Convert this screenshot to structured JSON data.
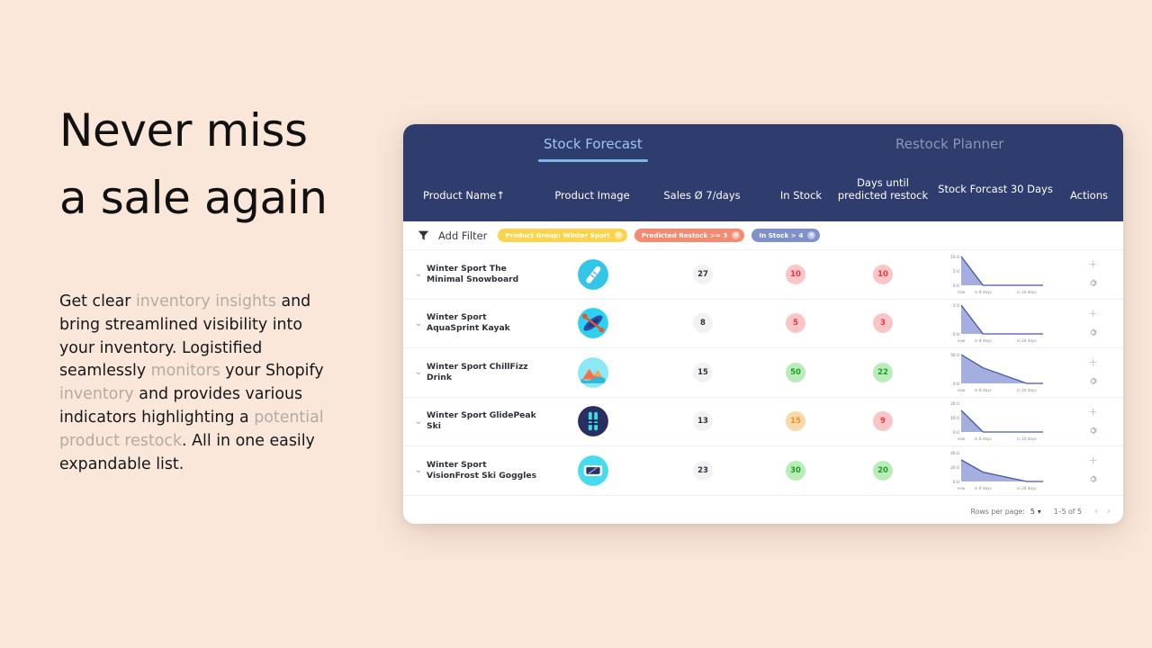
{
  "marketing": {
    "headline_line1": "Never miss",
    "headline_line2": "a sale again",
    "paragraph_parts": [
      {
        "text": "Get clear ",
        "muted": false
      },
      {
        "text": "inventory insights",
        "muted": true
      },
      {
        "text": " and bring streamlined visibility into your inventory. Logistified seamlessly ",
        "muted": false
      },
      {
        "text": "monitors",
        "muted": true
      },
      {
        "text": " your Shopify ",
        "muted": false
      },
      {
        "text": "inventory",
        "muted": true
      },
      {
        "text": " and provides various indicators highlighting a ",
        "muted": false
      },
      {
        "text": "potential product restock",
        "muted": true
      },
      {
        "text": ". All in one easily expandable list.",
        "muted": false
      }
    ]
  },
  "app": {
    "tabs": [
      {
        "label": "Stock Forecast",
        "active": true
      },
      {
        "label": "Restock Planner",
        "active": false
      }
    ],
    "columns": {
      "product_name": "Product Name",
      "product_name_sort": "↑",
      "product_image": "Product Image",
      "sales": "Sales Ø 7/days",
      "in_stock": "In Stock",
      "days_until_restock": "Days until predicted restock",
      "stock_forecast": "Stock Forcast 30 Days",
      "actions": "Actions"
    },
    "filter_bar": {
      "add_filter_label": "Add Filter",
      "chips": [
        {
          "label": "Product Group: Winter Sport",
          "color": "chip-yellow"
        },
        {
          "label": "Predicted Restock >= 3",
          "color": "chip-orange"
        },
        {
          "label": "In Stock > 4",
          "color": "chip-blue"
        }
      ]
    },
    "rows": [
      {
        "name": "Winter Sport The Minimal Snowboard",
        "icon": "snowboard-icon",
        "sales": "27",
        "in_stock": "10",
        "in_stock_color": "pill-red",
        "days_until_restock": "10",
        "days_color": "pill-red",
        "actions": [
          "plus-icon",
          "gear-icon"
        ]
      },
      {
        "name": "Winter Sport AquaSprint Kayak",
        "icon": "kayak-icon",
        "sales": "8",
        "in_stock": "5",
        "in_stock_color": "pill-red",
        "days_until_restock": "3",
        "days_color": "pill-red",
        "actions": [
          "plus-icon",
          "gear-icon"
        ]
      },
      {
        "name": "Winter Sport ChillFizz Drink",
        "icon": "mountain-drink-icon",
        "sales": "15",
        "in_stock": "50",
        "in_stock_color": "pill-green",
        "days_until_restock": "22",
        "days_color": "pill-green",
        "actions": [
          "plus-icon",
          "gear-icon"
        ]
      },
      {
        "name": "Winter Sport GlidePeak Ski",
        "icon": "ski-icon",
        "sales": "13",
        "in_stock": "15",
        "in_stock_color": "pill-amber",
        "days_until_restock": "9",
        "days_color": "pill-red",
        "actions": [
          "plus-icon",
          "gear-icon"
        ]
      },
      {
        "name": "Winter Sport VisionFrost Ski Goggles",
        "icon": "goggles-icon",
        "sales": "23",
        "in_stock": "30",
        "in_stock_color": "pill-green",
        "days_until_restock": "20",
        "days_color": "pill-green",
        "actions": [
          "plus-icon",
          "gear-icon"
        ]
      }
    ],
    "footer": {
      "rows_per_page_label": "Rows per page:",
      "rows_per_page_value": "5",
      "range_label": "1–5 of 5",
      "prev_icon": "‹",
      "next_icon": "›"
    }
  },
  "chart_data": [
    {
      "type": "area",
      "title": "Stock Forcast 30 Days — Winter Sport The Minimal Snowboard",
      "x": [
        "now",
        "in 8 days",
        "in 24 days"
      ],
      "xlabel": "",
      "ylabel": "U",
      "ylim": [
        0,
        10
      ],
      "yticks": [
        "0 U",
        "5 U",
        "10 U"
      ],
      "values": [
        10,
        0,
        0
      ],
      "grid": false,
      "legend": "none"
    },
    {
      "type": "area",
      "title": "Stock Forcast 30 Days — Winter Sport AquaSprint Kayak",
      "x": [
        "now",
        "in 8 days",
        "in 24 days"
      ],
      "xlabel": "",
      "ylabel": "U",
      "ylim": [
        0,
        5
      ],
      "yticks": [
        "0 U",
        "5 U"
      ],
      "values": [
        5,
        0,
        0
      ],
      "grid": false,
      "legend": "none"
    },
    {
      "type": "area",
      "title": "Stock Forcast 30 Days — Winter Sport ChillFizz Drink",
      "x": [
        "now",
        "in 8 days",
        "in 24 days"
      ],
      "xlabel": "",
      "ylabel": "U",
      "ylim": [
        0,
        50
      ],
      "yticks": [
        "0 U",
        "50 U"
      ],
      "values": [
        50,
        27,
        0
      ],
      "grid": false,
      "legend": "none"
    },
    {
      "type": "area",
      "title": "Stock Forcast 30 Days — Winter Sport GlidePeak Ski",
      "x": [
        "now",
        "in 8 days",
        "in 24 days"
      ],
      "xlabel": "",
      "ylabel": "U",
      "ylim": [
        0,
        20
      ],
      "yticks": [
        "0 U",
        "10 U",
        "20 U"
      ],
      "values": [
        15,
        0,
        0
      ],
      "grid": false,
      "legend": "none"
    },
    {
      "type": "area",
      "title": "Stock Forcast 30 Days — Winter Sport VisionFrost Ski Goggles",
      "x": [
        "now",
        "in 8 days",
        "in 24 days"
      ],
      "xlabel": "",
      "ylabel": "U",
      "ylim": [
        0,
        40
      ],
      "yticks": [
        "0 U",
        "20 U",
        "40 U"
      ],
      "values": [
        30,
        13,
        0
      ],
      "grid": false,
      "legend": "none"
    }
  ],
  "colors": {
    "page_background": "#fae7da",
    "card_header": "#2e3c6e",
    "tab_active": "#9dc6ef",
    "tab_inactive": "#8d96b4",
    "chart_line": "#4557a8",
    "chart_fill": "#9fabdd"
  }
}
